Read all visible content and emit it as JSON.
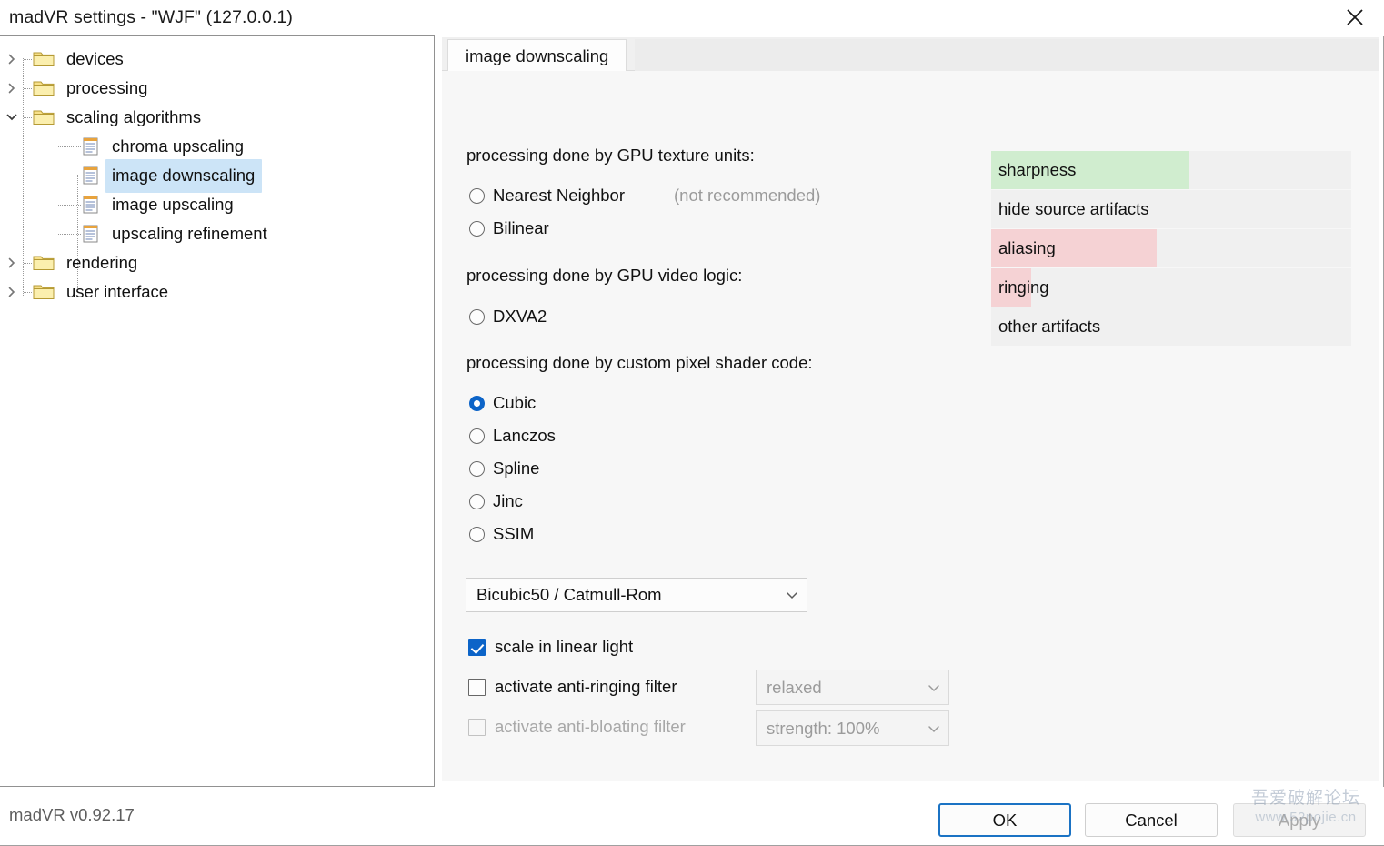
{
  "window": {
    "title": "madVR settings - \"WJF\" (127.0.0.1)",
    "close_icon": "close-icon",
    "version": "madVR v0.92.17"
  },
  "tree": {
    "items": [
      {
        "label": "devices",
        "type": "folder",
        "state": "collapsed",
        "depth": 0
      },
      {
        "label": "processing",
        "type": "folder",
        "state": "collapsed",
        "depth": 0
      },
      {
        "label": "scaling algorithms",
        "type": "folder",
        "state": "expanded",
        "depth": 0
      },
      {
        "label": "chroma upscaling",
        "type": "page",
        "state": "leaf",
        "depth": 1
      },
      {
        "label": "image downscaling",
        "type": "page",
        "state": "leaf",
        "depth": 1,
        "selected": true
      },
      {
        "label": "image upscaling",
        "type": "page",
        "state": "leaf",
        "depth": 1
      },
      {
        "label": "upscaling refinement",
        "type": "page",
        "state": "leaf",
        "depth": 1
      },
      {
        "label": "rendering",
        "type": "folder",
        "state": "collapsed",
        "depth": 0
      },
      {
        "label": "user interface",
        "type": "folder",
        "state": "collapsed",
        "depth": 0
      }
    ]
  },
  "tabs": [
    {
      "label": "image downscaling",
      "selected": true
    }
  ],
  "sections": {
    "texture_units": {
      "label": "processing done by GPU texture units:",
      "options": [
        {
          "label": "Nearest Neighbor",
          "selected": false,
          "hint": "(not recommended)"
        },
        {
          "label": "Bilinear",
          "selected": false
        }
      ]
    },
    "video_logic": {
      "label": "processing done by GPU video logic:",
      "options": [
        {
          "label": "DXVA2",
          "selected": false
        }
      ]
    },
    "pixel_shader": {
      "label": "processing done by custom pixel shader code:",
      "options": [
        {
          "label": "Cubic",
          "selected": true
        },
        {
          "label": "Lanczos",
          "selected": false
        },
        {
          "label": "Spline",
          "selected": false
        },
        {
          "label": "Jinc",
          "selected": false
        },
        {
          "label": "SSIM",
          "selected": false
        }
      ]
    }
  },
  "variant_combo": {
    "value": "Bicubic50 / Catmull-Rom",
    "chevron_icon": "chevron-down-icon"
  },
  "checkboxes": {
    "linear_light": {
      "label": "scale in linear light",
      "checked": true,
      "enabled": true
    },
    "anti_ringing": {
      "label": "activate anti-ringing filter",
      "checked": false,
      "enabled": true,
      "combo_value": "relaxed",
      "combo_enabled": false
    },
    "anti_bloating": {
      "label": "activate anti-bloating filter",
      "checked": false,
      "enabled": false,
      "combo_value": "strength: 100%",
      "combo_enabled": false
    }
  },
  "colors": {
    "good": "#d0edcf",
    "bad": "#f5d2d4",
    "track": "#f0f0f0",
    "accent": "#0c64c8",
    "selection": "#cce4f7",
    "primary_border": "#1b73c4"
  },
  "chart_data": {
    "type": "bar",
    "title": "quality ratings",
    "categories": [
      "sharpness",
      "hide source artifacts",
      "aliasing",
      "ringing",
      "other artifacts"
    ],
    "values": [
      55,
      0,
      46,
      11,
      0
    ],
    "bar_colors": [
      "#d0edcf",
      "#f0f0f0",
      "#f5d2d4",
      "#f5d2d4",
      "#f0f0f0"
    ],
    "kinds": [
      "good",
      "none",
      "bad",
      "bad",
      "none"
    ],
    "track_color": "#f0f0f0",
    "xlabel": "",
    "ylabel": "",
    "xlim": [
      0,
      100
    ],
    "grid": false,
    "legend": "none",
    "orientation": "horizontal"
  }
}
